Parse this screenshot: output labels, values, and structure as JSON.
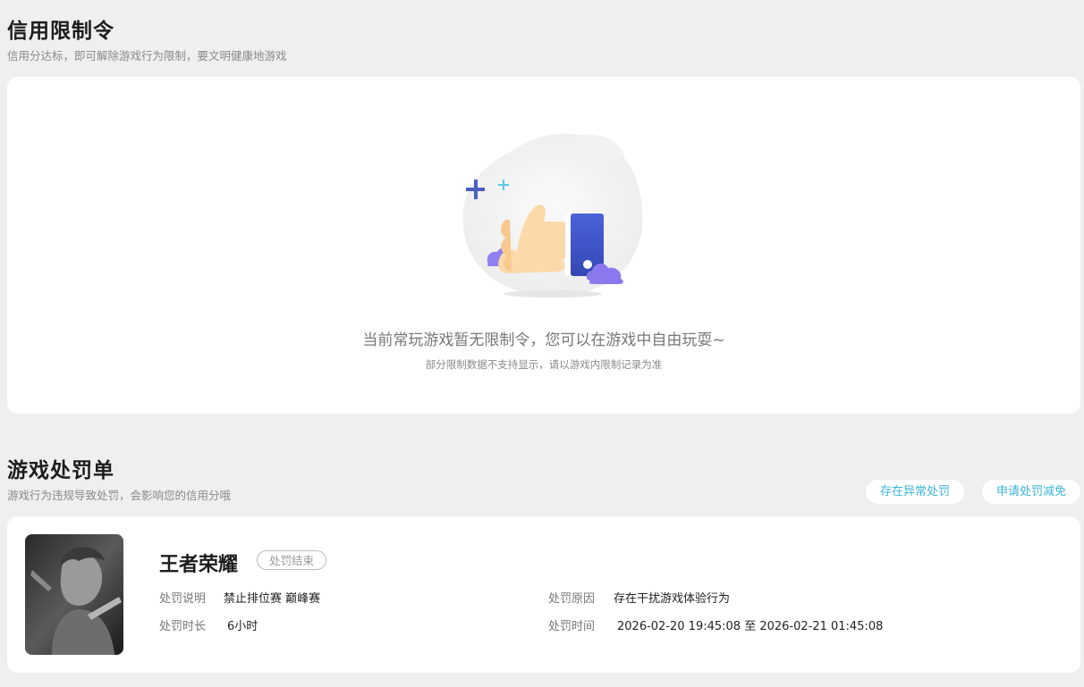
{
  "credit_section": {
    "title": "信用限制令",
    "subtitle": "信用分达标，即可解除游戏行为限制，要文明健康地游戏",
    "empty_message": "当前常玩游戏暂无限制令，您可以在游戏中自由玩耍~",
    "empty_note": "部分限制数据不支持显示，请以游戏内限制记录为准"
  },
  "penalty_section": {
    "title": "游戏处罚单",
    "subtitle": "游戏行为违规导致处罚，会影响您的信用分哦",
    "buttons": {
      "abnormal": "存在异常处罚",
      "reduce": "申请处罚减免"
    },
    "record": {
      "game": "王者荣耀",
      "status": "处罚结束",
      "desc_label": "处罚说明",
      "desc_value": "禁止排位赛 巅峰赛",
      "reason_label": "处罚原因",
      "reason_value": "存在干扰游戏体验行为",
      "duration_label": "处罚时长",
      "duration_value": "6小时",
      "time_label": "处罚时间",
      "time_value": "2026-02-20 19:45:08 至 2026-02-21 01:45:08"
    }
  },
  "colors": {
    "accent": "#3bb3d8",
    "page_bg": "#efefef",
    "card_bg": "#ffffff"
  }
}
